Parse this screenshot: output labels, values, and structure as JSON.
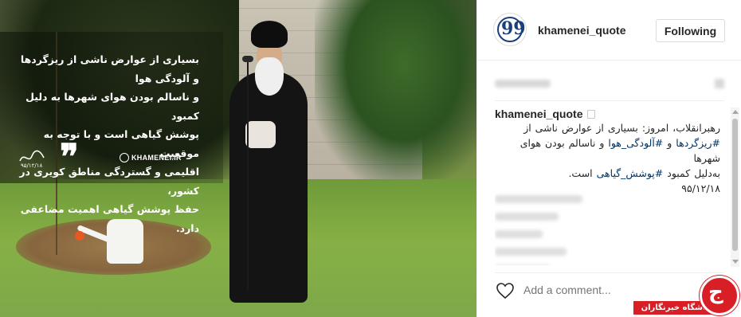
{
  "post": {
    "image_quote_lines": [
      "بسیاری از عوارض ناشی از ریزگردها و آلودگی هوا",
      "و ناسالم بودن هوای شهرها به دلیل کمبود",
      "پوشش گیاهی است و با توجه به موقعیت",
      "اقلیمی و گستردگی مناطق کویری در کشور،",
      "حفظ پوشش گیاهی اهمیت مضاعفی دارد."
    ],
    "image_signature_date": "۹۵/۱۲/۱۸",
    "image_brand": "KHAMENEI.IR"
  },
  "header": {
    "username": "khamenei_quote",
    "follow_label": "Following"
  },
  "caption": {
    "username": "khamenei_quote",
    "line1": "رهبرانقلاب، امروز: بسیاری از عوارض ناشی از",
    "hashtag1": "#ریزگردها",
    "and1": "و",
    "hashtag2": "#آلودگی_هوا",
    "line2_rest": "و ناسالم بودن هوای شهرها",
    "line3_start": "به‌دلیل کمبود",
    "hashtag3": "#پوشش_گیاهی",
    "line3_end": "است.",
    "date": "۹۵/۱۲/۱۸"
  },
  "footer": {
    "add_comment_placeholder": "Add a comment..."
  },
  "watermark": {
    "label": "باشگاه خبرنگاران"
  },
  "colors": {
    "hashtag": "#003569",
    "watermark_red": "#d91f26",
    "avatar_blue": "#1b3f7a"
  }
}
